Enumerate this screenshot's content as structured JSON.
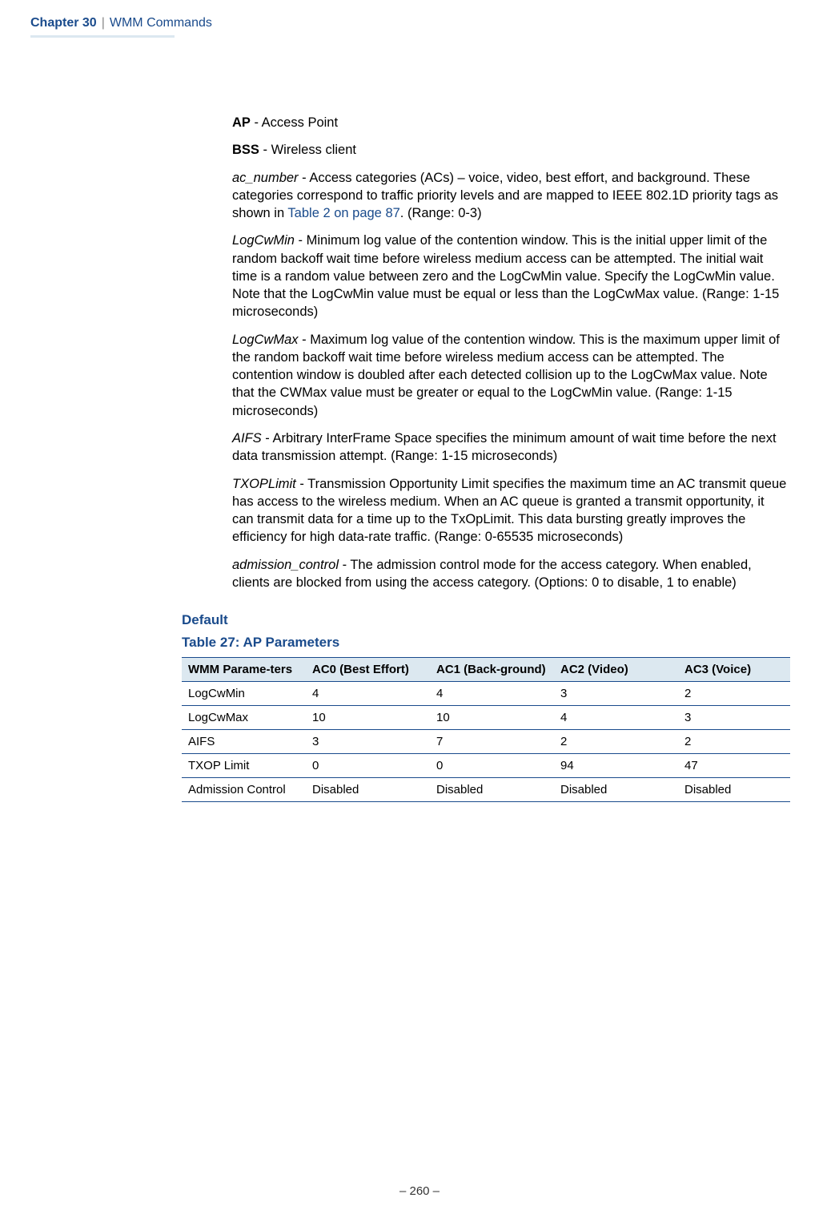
{
  "header": {
    "chapter": "Chapter 30",
    "section": "WMM Commands"
  },
  "content": {
    "ap_term": "AP",
    "ap_desc": " - Access Point",
    "bss_term": "BSS",
    "bss_desc": " - Wireless client",
    "ac_number_term": "ac_number",
    "ac_number_desc_1": " -  Access categories (ACs) – voice, video, best effort, and background. These categories correspond to traffic priority levels and are mapped to IEEE 802.1D priority tags as shown in ",
    "ac_number_link": "Table 2 on page 87",
    "ac_number_desc_2": ". (Range: 0-3)",
    "logcwmin_term": "LogCwMin",
    "logcwmin_desc": " - Minimum log value of the contention window. This is the initial upper limit of the random backoff wait time before wireless medium access can be attempted. The initial wait time is a random value between zero and the LogCwMin value. Specify the LogCwMin value. Note that the LogCwMin value must be equal or less than the LogCwMax value. (Range: 1-15 microseconds)",
    "logcwmax_term": "LogCwMax",
    "logcwmax_desc": " - Maximum log value of the contention window. This is the maximum upper limit of the random backoff wait time before wireless medium access can be attempted. The contention window is doubled after each detected collision up to the LogCwMax value. Note that the CWMax value must be greater or equal to the LogCwMin value. (Range: 1-15 microseconds)",
    "aifs_term": "AIFS",
    "aifs_desc": " - Arbitrary InterFrame Space specifies the minimum amount of wait time before the next data transmission attempt. (Range: 1-15 microseconds)",
    "txop_term": "TXOPLimit",
    "txop_desc": " - Transmission Opportunity  Limit specifies the maximum time an AC transmit queue has access to the wireless medium. When an AC queue is granted a transmit opportunity, it can transmit data for a time up to the TxOpLimit. This data bursting greatly improves the efficiency for high data-rate traffic. (Range: 0-65535 microseconds)",
    "adm_term": "admission_control",
    "adm_desc": " - The admission control mode for the access category. When enabled, clients are blocked from using the access category. (Options: 0 to disable, 1 to enable)"
  },
  "default_heading": "Default",
  "table_caption": "Table 27: AP Parameters",
  "table": {
    "headers": [
      "WMM Parame-ters",
      "AC0 (Best Effort)",
      "AC1 (Back-ground)",
      "AC2 (Video)",
      "AC3 (Voice)"
    ],
    "rows": [
      [
        "LogCwMin",
        "4",
        "4",
        "3",
        "2"
      ],
      [
        "LogCwMax",
        "10",
        "10",
        "4",
        "3"
      ],
      [
        "AIFS",
        "3",
        "7",
        "2",
        "2"
      ],
      [
        "TXOP Limit",
        "0",
        "0",
        "94",
        "47"
      ],
      [
        "Admission Control",
        "Disabled",
        "Disabled",
        "Disabled",
        "Disabled"
      ]
    ]
  },
  "footer": "–  260  –"
}
